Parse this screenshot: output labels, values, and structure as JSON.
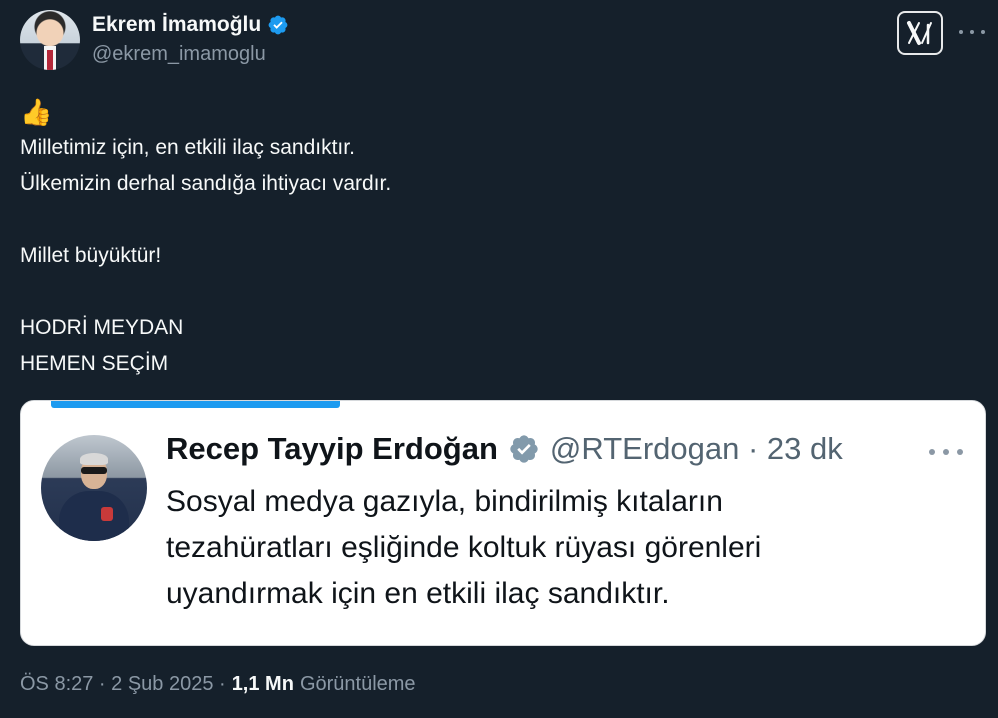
{
  "author": {
    "display_name": "Ekrem İmamoğlu",
    "handle": "@ekrem_imamoglu"
  },
  "icons": {
    "verified": "verified-badge-icon",
    "more": "more-options-icon",
    "x_logo": "x-logo-icon",
    "thumb": "thumbs-up-icon"
  },
  "colors": {
    "verified_blue": "#1d9bf0",
    "background": "#15202b"
  },
  "tweet": {
    "emoji": "👍",
    "lines": [
      "Milletimiz için, en etkili ilaç sandıktır.",
      "Ülkemizin derhal sandığa ihtiyacı vardır.",
      "",
      "Millet büyüktür!",
      "",
      "HODRİ MEYDAN",
      "HEMEN SEÇİM"
    ]
  },
  "quoted": {
    "display_name": "Recep Tayyip Erdoğan",
    "handle_time": "@RTErdogan · 23 dk",
    "lines": [
      "Sosyal medya gazıyla, bindirilmiş kıtaların",
      "tezahüratları eşliğinde koltuk rüyası görenleri",
      "uyandırmak için en etkili ilaç sandıktır."
    ],
    "progress_fraction": 0.3
  },
  "footer": {
    "timestamp": "ÖS 8:27 · 2 Şub 2025 ·",
    "views_count": "1,1 Mn",
    "views_label": "Görüntüleme"
  }
}
